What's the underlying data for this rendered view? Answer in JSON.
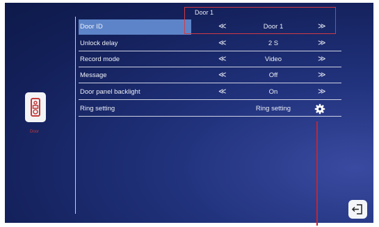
{
  "header": {
    "door_title": "Door 1"
  },
  "device": {
    "label": "Door",
    "icon": "doorbell-icon"
  },
  "settings": [
    {
      "name": "Door ID",
      "value": "Door 1",
      "control": "arrows"
    },
    {
      "name": "Unlock delay",
      "value": "2 S",
      "control": "arrows"
    },
    {
      "name": "Record mode",
      "value": "Video",
      "control": "arrows"
    },
    {
      "name": "Message",
      "value": "Off",
      "control": "arrows"
    },
    {
      "name": "Door panel backlight",
      "value": "On",
      "control": "arrows"
    },
    {
      "name": "Ring setting",
      "value": "Ring setting",
      "control": "gear"
    }
  ],
  "arrows": {
    "left": "≪",
    "right": "≫"
  },
  "icons": {
    "settings": "gear-icon",
    "exit": "exit-icon"
  },
  "colors": {
    "highlight": "#5d84c8",
    "annotation": "#d23a44"
  }
}
